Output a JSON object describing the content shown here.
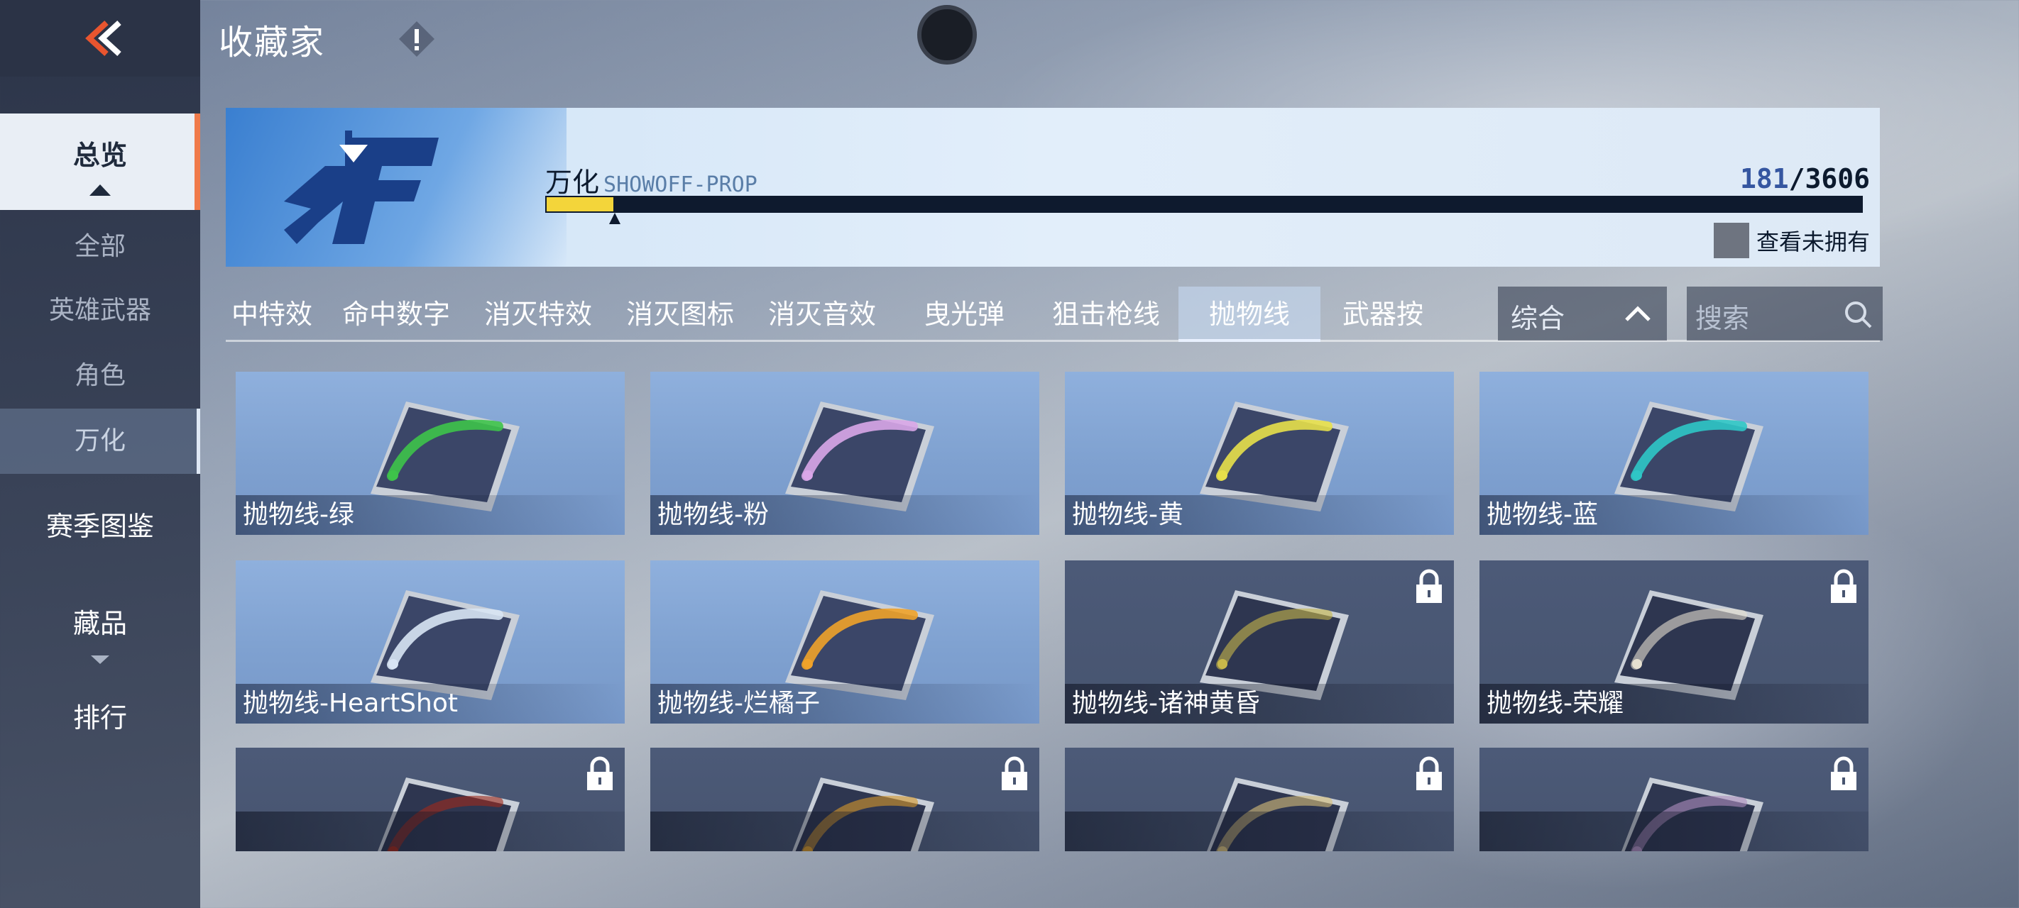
{
  "header": {
    "title": "收藏家",
    "back_icon": "chevron-back-icon",
    "info_icon": "exclamation-icon"
  },
  "sidebar": {
    "items": [
      {
        "label": "总览"
      },
      {
        "label": "全部"
      },
      {
        "label": "英雄武器"
      },
      {
        "label": "角色"
      },
      {
        "label": "万化"
      },
      {
        "label": "赛季图鉴"
      },
      {
        "label": "藏品"
      },
      {
        "label": "排行"
      }
    ]
  },
  "banner": {
    "label": "万化",
    "sublabel": "SHOWOFF-PROP",
    "owned": "181",
    "separator": "/",
    "total": "3606",
    "progress_fraction": 0.0502,
    "view_unowned_label": "查看未拥有"
  },
  "tabs": {
    "items": [
      "中特效",
      "命中数字",
      "消灭特效",
      "消灭图标",
      "消灭音效",
      "曳光弹",
      "狙击枪线",
      "抛物线",
      "武器按"
    ],
    "active": "抛物线",
    "sort_label": "综合",
    "search_placeholder": "搜索"
  },
  "grid": {
    "items": [
      {
        "label": "抛物线-绿",
        "locked": false,
        "color": "#3ec34a"
      },
      {
        "label": "抛物线-粉",
        "locked": false,
        "color": "#d9a6e8"
      },
      {
        "label": "抛物线-黄",
        "locked": false,
        "color": "#e8e04a"
      },
      {
        "label": "抛物线-蓝",
        "locked": false,
        "color": "#2fc6c6"
      },
      {
        "label": "抛物线-HeartShot",
        "locked": false,
        "color": "#d8e4f4"
      },
      {
        "label": "抛物线-烂橘子",
        "locked": false,
        "color": "#f0a22a"
      },
      {
        "label": "抛物线-诸神黄昏",
        "locked": true,
        "color": "#c8b84a"
      },
      {
        "label": "抛物线-荣耀",
        "locked": true,
        "color": "#e6e0d0"
      },
      {
        "label": "",
        "locked": true,
        "color": "#a02a1a"
      },
      {
        "label": "",
        "locked": true,
        "color": "#d89a2a"
      },
      {
        "label": "",
        "locked": true,
        "color": "#d8c07a"
      },
      {
        "label": "",
        "locked": true,
        "color": "#b090c0"
      }
    ]
  },
  "colors": {
    "accent": "#f07a4a",
    "progress": "#f3d53a",
    "brand_blue": "#2a5db0"
  }
}
